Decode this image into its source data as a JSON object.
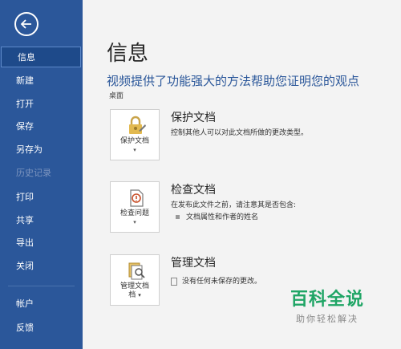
{
  "sidebar": {
    "items": [
      {
        "label": "信息",
        "state": "active"
      },
      {
        "label": "新建",
        "state": "normal"
      },
      {
        "label": "打开",
        "state": "normal"
      },
      {
        "label": "保存",
        "state": "normal"
      },
      {
        "label": "另存为",
        "state": "normal"
      },
      {
        "label": "历史记录",
        "state": "disabled"
      },
      {
        "label": "打印",
        "state": "normal"
      },
      {
        "label": "共享",
        "state": "normal"
      },
      {
        "label": "导出",
        "state": "normal"
      },
      {
        "label": "关闭",
        "state": "normal"
      },
      {
        "label": "帐户",
        "state": "normal"
      },
      {
        "label": "反馈",
        "state": "normal"
      }
    ],
    "accent": "#2b579a"
  },
  "main": {
    "title": "信息",
    "subtitle": "视频提供了功能强大的方法帮助您证明您的观点",
    "location": "桌面",
    "sections": [
      {
        "button": "保护文档",
        "icon": "lock-icon",
        "title": "保护文档",
        "desc": "控制其他人可以对此文档所做的更改类型。"
      },
      {
        "button": "检查问题",
        "icon": "inspect-document-icon",
        "title": "检查文档",
        "desc": "在发布此文件之前，请注意其是否包含:",
        "bullet": "文档属性和作者的姓名"
      },
      {
        "button": "管理文档",
        "button_line2": "档",
        "icon": "manage-document-icon",
        "title": "管理文档",
        "desc": "没有任何未保存的更改。"
      }
    ]
  },
  "watermark": {
    "title": "百科全说",
    "sub": "助你轻松解决"
  }
}
